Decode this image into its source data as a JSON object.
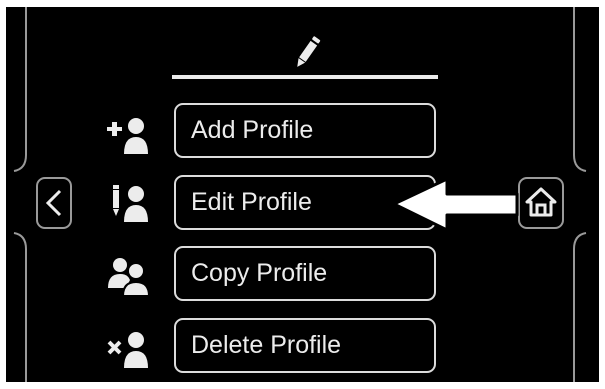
{
  "header": {
    "icon": "pencil-icon"
  },
  "menu": {
    "items": [
      {
        "label": "Add Profile",
        "icon": "add-profile-icon"
      },
      {
        "label": "Edit Profile",
        "icon": "edit-profile-icon"
      },
      {
        "label": "Copy Profile",
        "icon": "copy-profile-icon"
      },
      {
        "label": "Delete Profile",
        "icon": "delete-profile-icon"
      }
    ]
  },
  "nav": {
    "back_icon": "chevron-left-icon",
    "home_icon": "home-icon"
  },
  "annotation": {
    "icon": "arrow-left-icon",
    "target": "Edit Profile"
  },
  "colors": {
    "background": "#000000",
    "foreground": "#ececec",
    "outline": "#dcdcdc",
    "arrow": "#ffffff"
  }
}
